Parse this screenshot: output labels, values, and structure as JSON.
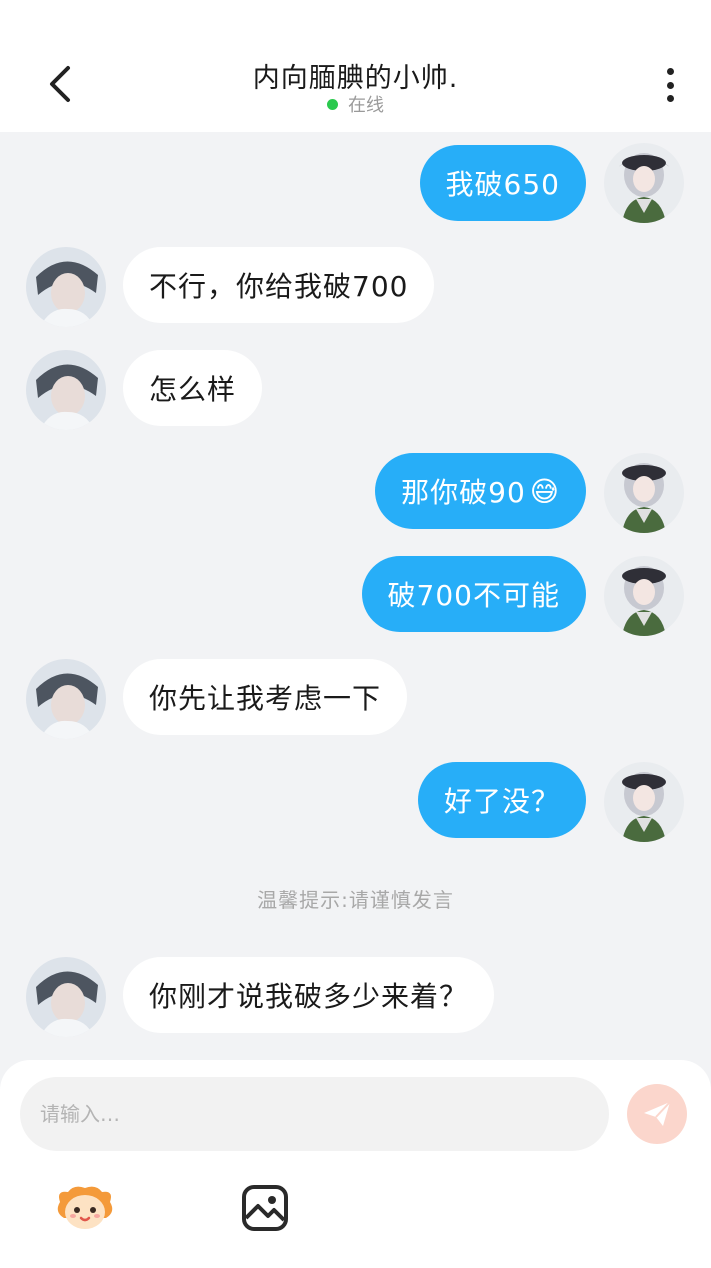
{
  "header": {
    "title": "内向腼腆的小帅.",
    "status": "在线"
  },
  "messages": [
    {
      "side": "out",
      "text": "我破650"
    },
    {
      "side": "in",
      "text": "不行，你给我破700"
    },
    {
      "side": "in",
      "text": "怎么样"
    },
    {
      "side": "out",
      "text": "那你破90",
      "emoji": "😅"
    },
    {
      "side": "out",
      "text": "破700不可能"
    },
    {
      "side": "in",
      "text": "你先让我考虑一下"
    },
    {
      "side": "out",
      "text": "好了没？"
    },
    {
      "side": "in",
      "text": "你刚才说我破多少来着？"
    }
  ],
  "notice": "温馨提示:请谨慎发言",
  "composer": {
    "placeholder": "请输入…"
  },
  "colors": {
    "accent_bubble": "#27aef8",
    "online_dot": "#2bc94e",
    "send_button": "#fbd6cc",
    "background": "#f2f3f5"
  },
  "icons": [
    "back-arrow-icon",
    "more-vertical-icon",
    "send-icon",
    "sticker-icon",
    "image-icon"
  ]
}
